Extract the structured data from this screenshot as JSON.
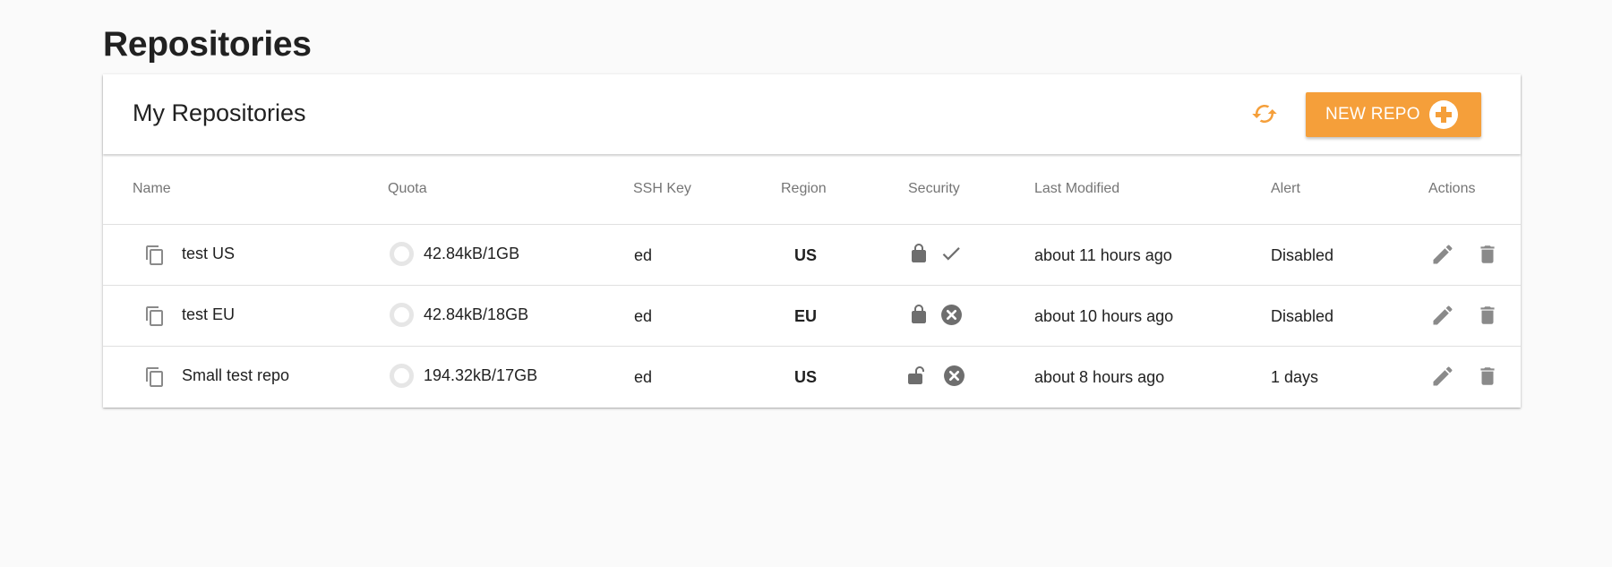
{
  "page": {
    "title": "Repositories"
  },
  "card": {
    "title": "My Repositories",
    "refresh_icon": "refresh-icon",
    "new_repo_label": "NEW REPO",
    "accent_color": "#f59f3a"
  },
  "table": {
    "columns": [
      "Name",
      "Quota",
      "SSH Key",
      "Region",
      "Security",
      "Last Modified",
      "Alert",
      "Actions"
    ],
    "rows": [
      {
        "name": "test US",
        "quota": "42.84kB/1GB",
        "ssh_key": "ed",
        "region": "US",
        "lock": "locked",
        "status": "check",
        "last_modified": "about 11 hours ago",
        "alert": "Disabled"
      },
      {
        "name": "test EU",
        "quota": "42.84kB/18GB",
        "ssh_key": "ed",
        "region": "EU",
        "lock": "locked",
        "status": "error",
        "last_modified": "about 10 hours ago",
        "alert": "Disabled"
      },
      {
        "name": "Small test repo",
        "quota": "194.32kB/17GB",
        "ssh_key": "ed",
        "region": "US",
        "lock": "unlocked",
        "status": "error",
        "last_modified": "about 8 hours ago",
        "alert": "1 days"
      }
    ]
  }
}
